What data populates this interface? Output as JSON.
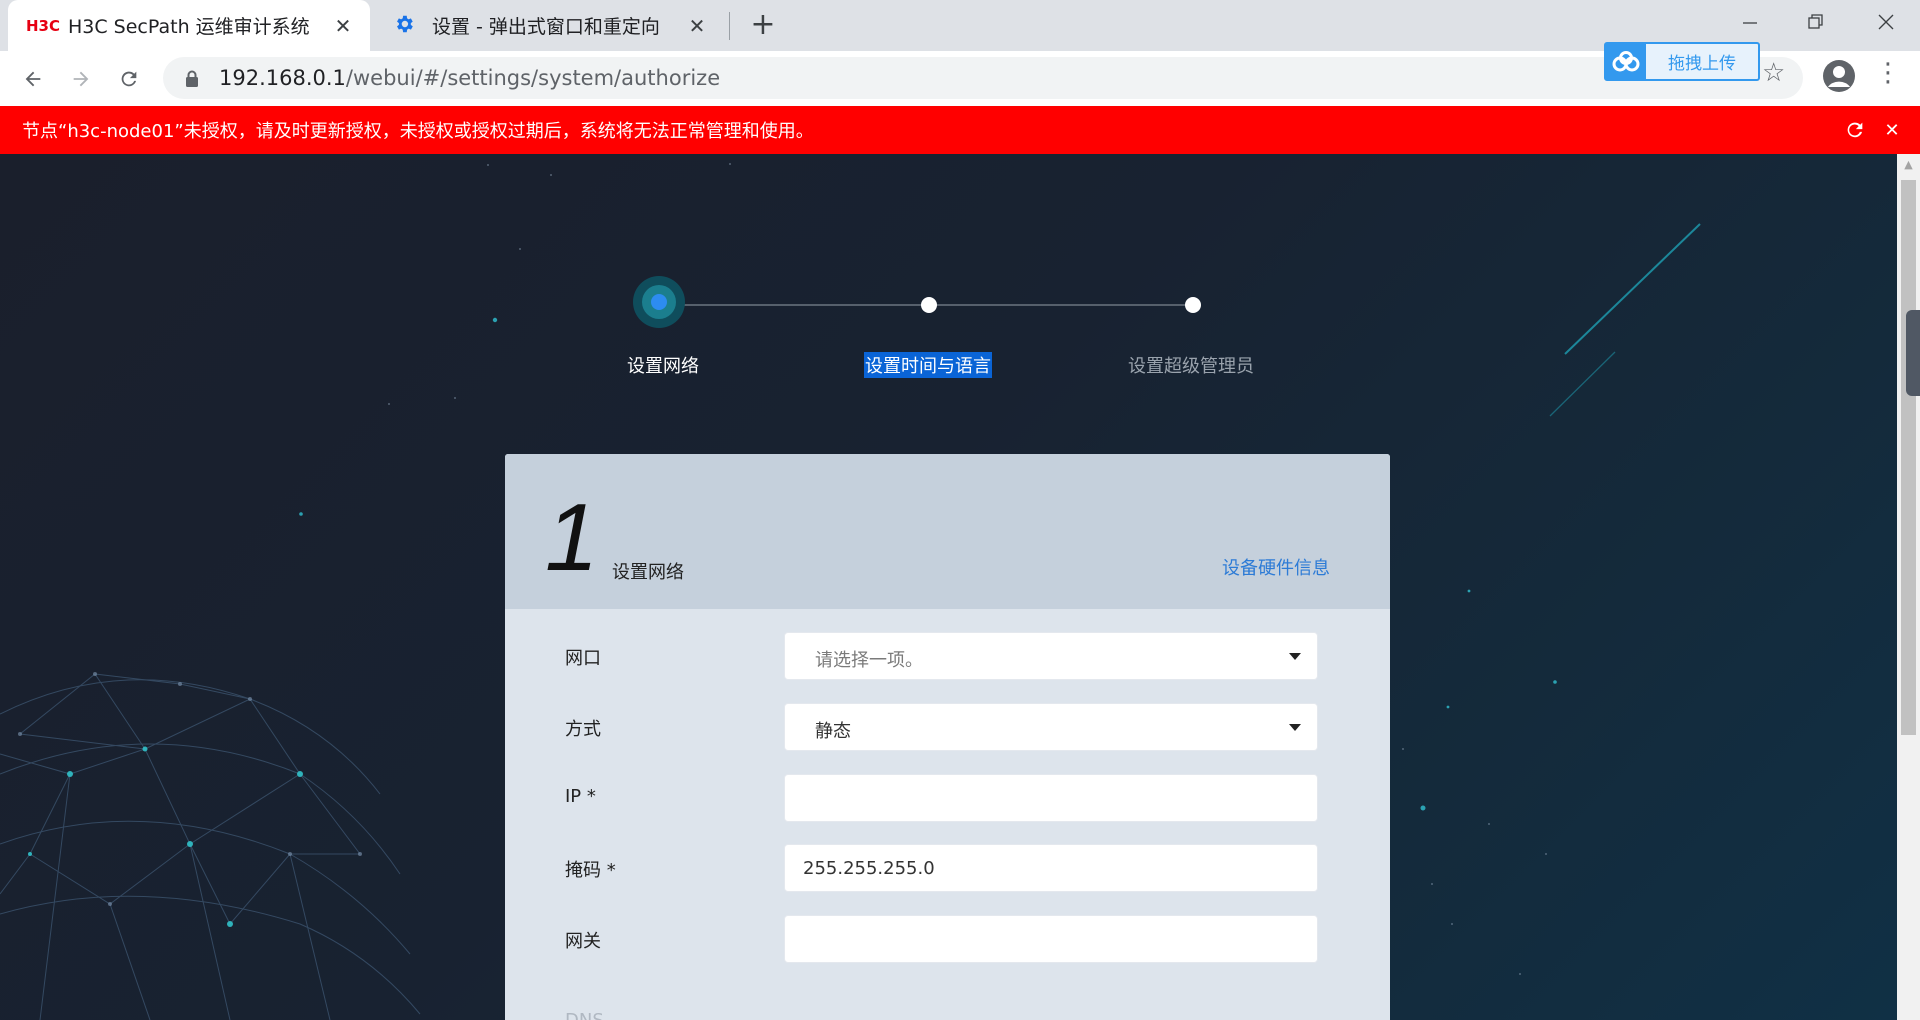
{
  "browser": {
    "tabs": [
      {
        "favicon_text": "H3C",
        "title": "H3C SecPath 运维审计系统",
        "active": true
      },
      {
        "favicon": "gear-icon",
        "title": "设置 - 弹出式窗口和重定向",
        "active": false
      }
    ],
    "url_host": "192.168.0.1",
    "url_path": "/webui/#/settings/system/authorize",
    "extension_label": "拖拽上传"
  },
  "banner": {
    "text": "节点“h3c-node01”未授权，请及时更新授权，未授权或授权过期后，系统将无法正常管理和使用。",
    "color": "#ff0000"
  },
  "stepper": {
    "steps": [
      {
        "label": "设置网络",
        "state": "current"
      },
      {
        "label": "设置时间与语言",
        "state": "pending"
      },
      {
        "label": "设置超级管理员",
        "state": "pending"
      }
    ]
  },
  "card": {
    "step_number": "1",
    "title": "设置网络",
    "hardware_link": "设备硬件信息",
    "fields": {
      "port": {
        "label": "网口",
        "placeholder": "请选择一项。"
      },
      "mode": {
        "label": "方式",
        "value": "静态"
      },
      "ip": {
        "label": "IP *",
        "value": ""
      },
      "mask": {
        "label": "掩码 *",
        "value": "255.255.255.0"
      },
      "gateway": {
        "label": "网关",
        "value": ""
      },
      "dns": {
        "label": "DNS"
      }
    }
  },
  "colors": {
    "accent": "#2d8cf0",
    "link": "#2d7bd6",
    "selection": "#0a64d6"
  }
}
